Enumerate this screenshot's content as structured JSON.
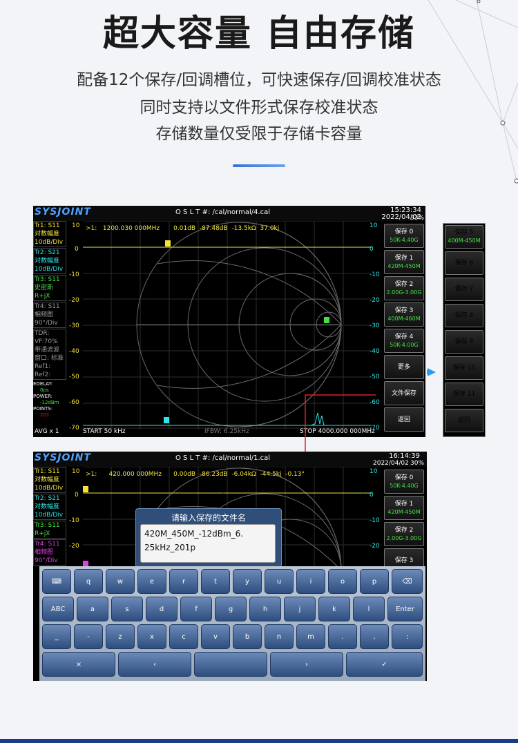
{
  "hero": {
    "title": "超大容量 自由存储",
    "lines": [
      "配备12个保存/回调槽位，可快速保存/回调校准状态",
      "同时支持以文件形式保存校准状态",
      "存储数量仅受限于存储卡容量"
    ]
  },
  "screen1": {
    "brand": "SYSJOINT",
    "cal": "O S L T #:     /cal/normal/4.cal",
    "time": "15:23:34",
    "date": "2022/04/02",
    "battery": "33%",
    "marker_line": ">1:   1200.030 000MHz       0.01dB  -87.48dB  -13.5kΩ  37.0kj",
    "traces": [
      {
        "name": "Tr1:  S11",
        "mode": "对数幅度",
        "scale": "10dB/Div"
      },
      {
        "name": "Tr2:  S21",
        "mode": "对数幅度",
        "scale": "10dB/Div"
      },
      {
        "name": "Tr3:  S11",
        "mode": "史密斯",
        "scale": "R+jX"
      },
      {
        "name": "Tr4:  S11",
        "mode": "相频图",
        "scale": "90°/Div"
      }
    ],
    "tdr": [
      "TDR:",
      "VF:70%",
      "带通滤波",
      "窗口: 标准",
      "Ref1:",
      "Ref2:"
    ],
    "edelay_label": "EDELAY:",
    "edelay": "0ps",
    "power_label": "POWER:",
    "power": "-12dBm",
    "points_label": "POINTS:",
    "points": "201",
    "avg": "AVG x 1",
    "start": "START      50 kHz",
    "ifbw": "IFBW: 6.25kHz",
    "stop": "STOP 4000.000 000MHz",
    "ylabels": [
      "10",
      "0",
      "-10",
      "-20",
      "-30",
      "-40",
      "-50",
      "-60",
      "-70"
    ],
    "softkeys": [
      {
        "label": "保存 0",
        "sub": "50K-4.40G"
      },
      {
        "label": "保存 1",
        "sub": "420M-450M"
      },
      {
        "label": "保存 2",
        "sub": "2.00G-3.00G"
      },
      {
        "label": "保存 3",
        "sub": "400M-460M"
      },
      {
        "label": "保存 4",
        "sub": "50K-4.00G"
      },
      {
        "label": "更多",
        "sub": ""
      },
      {
        "label": "文件保存",
        "sub": ""
      },
      {
        "label": "返回",
        "sub": ""
      }
    ]
  },
  "side": {
    "keys": [
      {
        "label": "保存 5",
        "sub": "400M-450M"
      },
      {
        "label": "保存 6",
        "sub": ""
      },
      {
        "label": "保存 7",
        "sub": ""
      },
      {
        "label": "保存 8",
        "sub": ""
      },
      {
        "label": "保存 9",
        "sub": ""
      },
      {
        "label": "保存 10",
        "sub": ""
      },
      {
        "label": "保存 11",
        "sub": ""
      },
      {
        "label": "返回",
        "sub": ""
      }
    ]
  },
  "screen2": {
    "brand": "SYSJOINT",
    "cal": "O S L T #:     /cal/normal/1.cal",
    "time": "16:14:39",
    "date": "2022/04/02",
    "battery": "30%",
    "marker_line": ">1:      420.000 000MHz      0.00dB  -86.23dB  -6.04kΩ  -44.5kj  -0.13°",
    "traces": [
      {
        "name": "Tr1:  S11",
        "mode": "对数幅度",
        "scale": "10dB/Div"
      },
      {
        "name": "Tr2:  S21",
        "mode": "对数幅度",
        "scale": "10dB/Div"
      },
      {
        "name": "Tr3:  S11",
        "mode": "R+jX",
        "scale": ""
      },
      {
        "name": "Tr4:  S11",
        "mode": "相频图",
        "scale": "90°/Div"
      }
    ],
    "ylabels": [
      "10",
      "0",
      "-10",
      "-20"
    ],
    "softkeys": [
      {
        "label": "保存 0",
        "sub": "50K-4.40G"
      },
      {
        "label": "保存 1",
        "sub": "420M-450M"
      },
      {
        "label": "保存 2",
        "sub": "2.00G-3.00G"
      },
      {
        "label": "保存 3",
        "sub": ""
      }
    ]
  },
  "dialog": {
    "title": "请输入保存的文件名",
    "value_line1": "420M_450M_-12dBm_6.",
    "value_line2": "25kHz_201p"
  },
  "keyboard": {
    "row1": [
      "⌨",
      "q",
      "w",
      "e",
      "r",
      "t",
      "y",
      "u",
      "i",
      "o",
      "p",
      "⌫"
    ],
    "row2": [
      "ABC",
      "a",
      "s",
      "d",
      "f",
      "g",
      "h",
      "j",
      "k",
      "l",
      "Enter"
    ],
    "row3": [
      "_",
      "-",
      "z",
      "x",
      "c",
      "v",
      "b",
      "n",
      "m",
      ".",
      ",",
      ":"
    ],
    "row4": [
      "×",
      "‹",
      "",
      "›",
      "✓"
    ]
  },
  "colors": {
    "accent": "#2a9cf0",
    "trace_yellow": "#f4e43a",
    "trace_cyan": "#2ee6e6",
    "trace_green": "#44e044",
    "marker_red": "#e02020"
  }
}
